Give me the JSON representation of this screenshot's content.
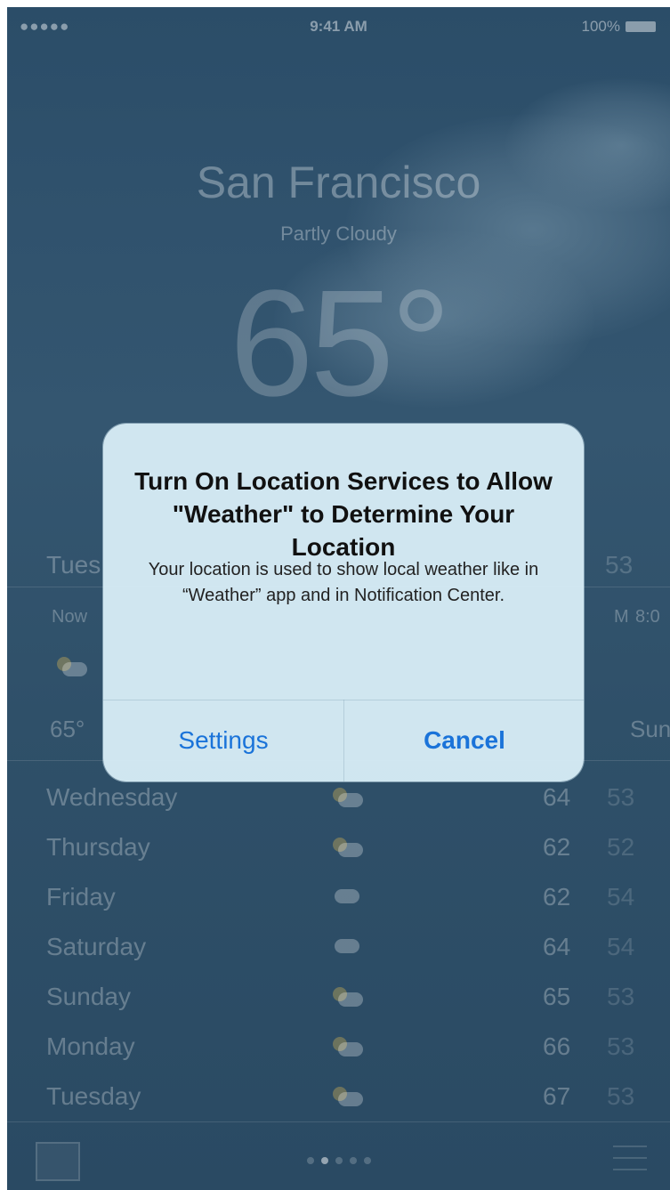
{
  "status_bar": {
    "signal": "●●●●● ",
    "time": "9:41 AM",
    "battery": "100%"
  },
  "weather": {
    "city": "San Francisco",
    "condition": "Partly Cloudy",
    "temperature": "65°",
    "today_day": "Tues",
    "today_lo": "53",
    "hourly_now": "Now",
    "hourly_right_label": "8:0",
    "hourly_right_prefix": "M",
    "hourly_now_temp": "65°",
    "hourly_right_temp": "Sun",
    "forecast": [
      {
        "day": "Wednesday",
        "hi": "64",
        "lo": "53",
        "icon": "partly-cloudy-icon"
      },
      {
        "day": "Thursday",
        "hi": "62",
        "lo": "52",
        "icon": "partly-cloudy-icon"
      },
      {
        "day": "Friday",
        "hi": "62",
        "lo": "54",
        "icon": "cloudy-icon"
      },
      {
        "day": "Saturday",
        "hi": "64",
        "lo": "54",
        "icon": "cloudy-icon"
      },
      {
        "day": "Sunday",
        "hi": "65",
        "lo": "53",
        "icon": "partly-cloudy-icon"
      },
      {
        "day": "Monday",
        "hi": "66",
        "lo": "53",
        "icon": "partly-cloudy-icon"
      },
      {
        "day": "Tuesday",
        "hi": "67",
        "lo": "53",
        "icon": "partly-cloudy-icon"
      }
    ]
  },
  "alert": {
    "title": "Turn On Location Services to Allow \"Weather\" to Determine Your Location",
    "message": "Your location is used to show local weather like in “Weather” app and in Notification Center.",
    "settings_label": "Settings",
    "cancel_label": "Cancel",
    "button_color": "#1a73d9"
  },
  "bottom_bar": {
    "page_count": 5,
    "active_page": 1
  }
}
